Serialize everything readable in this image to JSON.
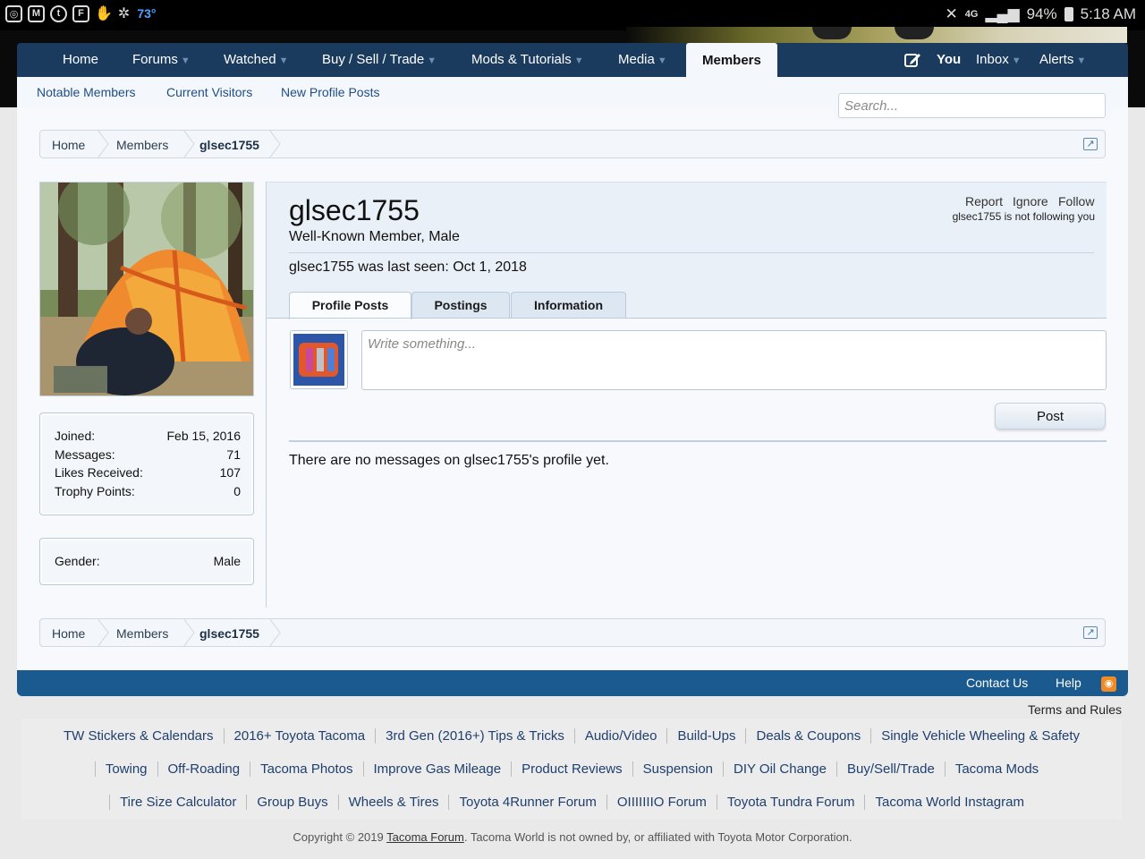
{
  "status_bar": {
    "temperature": "73°",
    "network": "4G",
    "battery": "94%",
    "time": "5:18 AM",
    "left_icons": [
      "instagram-icon",
      "gmail-icon",
      "tumblr-icon",
      "flipboard-icon",
      "hand-icon",
      "fan-icon"
    ]
  },
  "nav": {
    "home": "Home",
    "forums": "Forums",
    "watched": "Watched",
    "buy_sell": "Buy / Sell / Trade",
    "mods": "Mods & Tutorials",
    "media": "Media",
    "members": "Members",
    "you": "You",
    "inbox": "Inbox",
    "alerts": "Alerts"
  },
  "subnav": {
    "notable": "Notable Members",
    "visitors": "Current Visitors",
    "new_posts": "New Profile Posts"
  },
  "search": {
    "placeholder": "Search..."
  },
  "breadcrumb": [
    "Home",
    "Members",
    "glsec1755"
  ],
  "sidebar": {
    "stats": [
      {
        "label": "Joined:",
        "value": "Feb 15, 2016"
      },
      {
        "label": "Messages:",
        "value": "71"
      },
      {
        "label": "Likes Received:",
        "value": "107"
      },
      {
        "label": "Trophy Points:",
        "value": "0"
      }
    ],
    "gender_label": "Gender:",
    "gender_value": "Male"
  },
  "profile": {
    "username": "glsec1755",
    "title": "Well-Known Member, Male",
    "last_seen": "glsec1755 was last seen: Oct 1, 2018",
    "actions": {
      "report": "Report",
      "ignore": "Ignore",
      "follow": "Follow"
    },
    "follow_status": "glsec1755 is not following you",
    "tabs": [
      "Profile Posts",
      "Postings",
      "Information"
    ],
    "write_placeholder": "Write something...",
    "post_button": "Post",
    "empty_message": "There are no messages on glsec1755's profile yet."
  },
  "footer": {
    "contact": "Contact Us",
    "help": "Help",
    "terms": "Terms and Rules",
    "links_row1": [
      "TW Stickers & Calendars",
      "2016+ Toyota Tacoma",
      "3rd Gen (2016+) Tips & Tricks",
      "Audio/Video",
      "Build-Ups",
      "Deals & Coupons",
      "Single Vehicle Wheeling & Safety"
    ],
    "links_row2": [
      "Towing",
      "Off-Roading",
      "Tacoma Photos",
      "Improve Gas Mileage",
      "Product Reviews",
      "Suspension",
      "DIY Oil Change",
      "Buy/Sell/Trade",
      "Tacoma Mods"
    ],
    "links_row3": [
      "Tire Size Calculator",
      "Group Buys",
      "Wheels & Tires",
      "Toyota 4Runner Forum",
      "OIIIIIIIO Forum",
      "Toyota Tundra Forum",
      "Tacoma World Instagram"
    ],
    "copyright_prefix": "Copyright © 2019",
    "copyright_link": "Tacoma Forum",
    "copyright_suffix": ". Tacoma World is not owned by, or affiliated with Toyota Motor Corporation."
  },
  "colors": {
    "nav_bg": "#1a3a5e",
    "footer_bar": "#1b5a8f",
    "link": "#1f3f6e",
    "rss": "#f08a24"
  }
}
